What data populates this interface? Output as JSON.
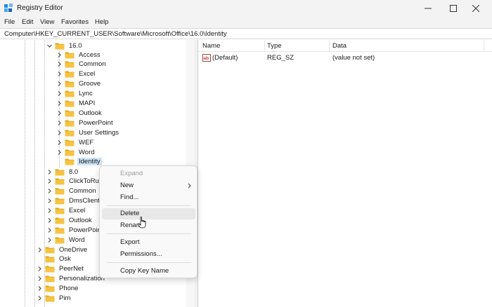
{
  "window": {
    "title": "Registry Editor",
    "minimize_icon": "minimize-icon",
    "maximize_icon": "maximize-icon",
    "close_icon": "close-icon"
  },
  "menubar": {
    "items": [
      {
        "label": "File"
      },
      {
        "label": "Edit"
      },
      {
        "label": "View"
      },
      {
        "label": "Favorites"
      },
      {
        "label": "Help"
      }
    ]
  },
  "address": {
    "path": "Computer\\HKEY_CURRENT_USER\\Software\\Microsoft\\Office\\16.0\\Identity"
  },
  "tree": {
    "parent": {
      "label": "16.0",
      "expanded": true
    },
    "children": [
      {
        "label": "Access"
      },
      {
        "label": "Common"
      },
      {
        "label": "Excel"
      },
      {
        "label": "Groove"
      },
      {
        "label": "Lync"
      },
      {
        "label": "MAPI"
      },
      {
        "label": "Outlook"
      },
      {
        "label": "PowerPoint"
      },
      {
        "label": "User Settings"
      },
      {
        "label": "WEF"
      },
      {
        "label": "Word"
      },
      {
        "label": "Identity",
        "selected": true
      }
    ],
    "siblings": [
      {
        "label": "8.0"
      },
      {
        "label": "ClickToRun"
      },
      {
        "label": "Common"
      },
      {
        "label": "DmsClient"
      },
      {
        "label": "Excel"
      },
      {
        "label": "Outlook"
      },
      {
        "label": "PowerPoint"
      },
      {
        "label": "Word"
      }
    ],
    "upper": [
      {
        "label": "OneDrive",
        "chevron": true
      },
      {
        "label": "Osk",
        "chevron": false
      },
      {
        "label": "PeerNet",
        "chevron": true
      },
      {
        "label": "Personalization",
        "chevron": true
      },
      {
        "label": "Phone",
        "chevron": true
      },
      {
        "label": "Pim",
        "chevron": true
      }
    ]
  },
  "list": {
    "columns": {
      "name": "Name",
      "type": "Type",
      "data": "Data"
    },
    "rows": [
      {
        "name": "(Default)",
        "type": "REG_SZ",
        "data": "(value not set)",
        "icon": "string-value-icon"
      }
    ]
  },
  "context_menu": {
    "items": {
      "expand": "Expand",
      "new": "New",
      "find": "Find...",
      "delete": "Delete",
      "rename": "Rename",
      "export": "Export",
      "permissions": "Permissions...",
      "copy_key_name": "Copy Key Name"
    },
    "hovered": "Delete",
    "disabled": [
      "Expand"
    ]
  },
  "colors": {
    "folder": "#f6c343",
    "folder_dark": "#e6a817",
    "selection": "#cce4f7",
    "menu_hover": "#e8e8e8"
  }
}
